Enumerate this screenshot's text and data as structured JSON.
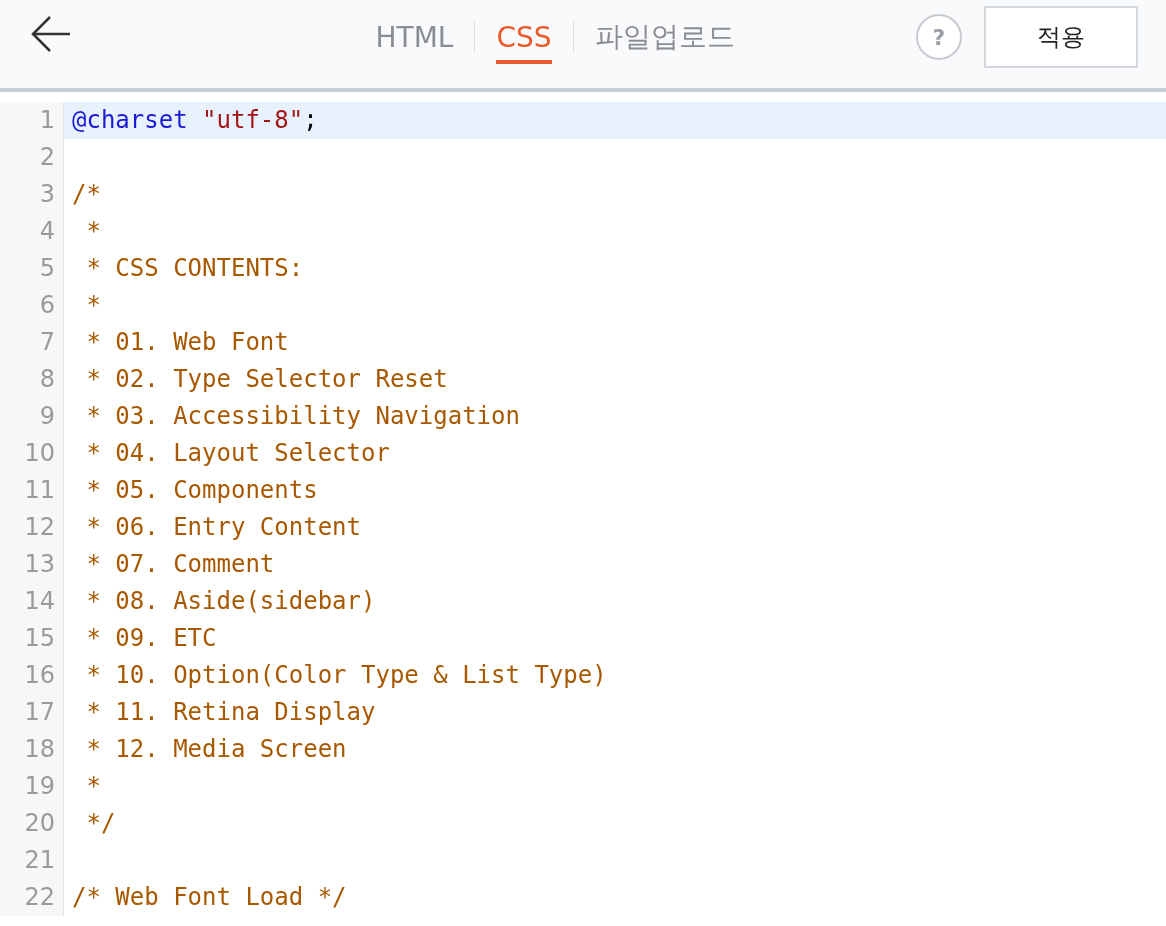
{
  "tabs": [
    {
      "label": "HTML",
      "selected": false
    },
    {
      "label": "CSS",
      "selected": true
    },
    {
      "label": "파일업로드",
      "selected": false
    }
  ],
  "help_button": "?",
  "apply_button": "적용",
  "editor": {
    "lines": [
      {
        "number": "1",
        "selected": true,
        "tokens": [
          {
            "kind": "keyword",
            "text": "@charset"
          },
          {
            "kind": "string",
            "text": " \"utf-8\""
          },
          {
            "kind": "plain",
            "text": ";"
          }
        ]
      },
      {
        "number": "2",
        "selected": false
      },
      {
        "number": "3",
        "selected": false,
        "tokens": [
          {
            "kind": "comment",
            "text": "/*"
          }
        ]
      },
      {
        "number": "4",
        "selected": false,
        "tokens": [
          {
            "kind": "comment",
            "text": " *"
          }
        ]
      },
      {
        "number": "5",
        "selected": false,
        "tokens": [
          {
            "kind": "comment",
            "text": " * CSS CONTENTS:"
          }
        ]
      },
      {
        "number": "6",
        "selected": false,
        "tokens": [
          {
            "kind": "comment",
            "text": " *"
          }
        ]
      },
      {
        "number": "7",
        "selected": false,
        "tokens": [
          {
            "kind": "comment",
            "text": " * 01. Web Font"
          }
        ]
      },
      {
        "number": "8",
        "selected": false,
        "tokens": [
          {
            "kind": "comment",
            "text": " * 02. Type Selector Reset"
          }
        ]
      },
      {
        "number": "9",
        "selected": false,
        "tokens": [
          {
            "kind": "comment",
            "text": " * 03. Accessibility Navigation"
          }
        ]
      },
      {
        "number": "10",
        "selected": false,
        "tokens": [
          {
            "kind": "comment",
            "text": " * 04. Layout Selector"
          }
        ]
      },
      {
        "number": "11",
        "selected": false,
        "tokens": [
          {
            "kind": "comment",
            "text": " * 05. Components"
          }
        ]
      },
      {
        "number": "12",
        "selected": false,
        "tokens": [
          {
            "kind": "comment",
            "text": " * 06. Entry Content"
          }
        ]
      },
      {
        "number": "13",
        "selected": false,
        "tokens": [
          {
            "kind": "comment",
            "text": " * 07. Comment"
          }
        ]
      },
      {
        "number": "14",
        "selected": false,
        "tokens": [
          {
            "kind": "comment",
            "text": " * 08. Aside(sidebar)"
          }
        ]
      },
      {
        "number": "15",
        "selected": false,
        "tokens": [
          {
            "kind": "comment",
            "text": " * 09. ETC"
          }
        ]
      },
      {
        "number": "16",
        "selected": false,
        "tokens": [
          {
            "kind": "comment",
            "text": " * 10. Option(Color Type & List Type)"
          }
        ]
      },
      {
        "number": "17",
        "selected": false,
        "tokens": [
          {
            "kind": "comment",
            "text": " * 11. Retina Display"
          }
        ]
      },
      {
        "number": "18",
        "selected": false,
        "tokens": [
          {
            "kind": "comment",
            "text": " * 12. Media Screen"
          }
        ]
      },
      {
        "number": "19",
        "selected": false,
        "tokens": [
          {
            "kind": "comment",
            "text": " *"
          }
        ]
      },
      {
        "number": "20",
        "selected": false,
        "tokens": [
          {
            "kind": "comment",
            "text": " */"
          }
        ]
      },
      {
        "number": "21",
        "selected": false
      },
      {
        "number": "22",
        "selected": false,
        "tokens": [
          {
            "kind": "comment",
            "text": "/* Web Font Load */"
          }
        ]
      }
    ]
  }
}
